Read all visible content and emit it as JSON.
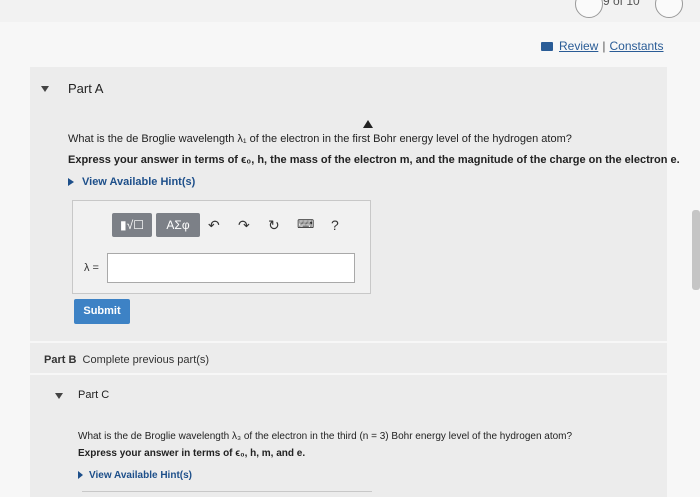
{
  "header": {
    "page_counter": "9 of 10",
    "review_label": "Review",
    "separator": "|",
    "constants_label": "Constants"
  },
  "partA": {
    "title": "Part A",
    "question": "What is the de Broglie wavelength λ₁ of the electron in the first Bohr energy level of the hydrogen atom?",
    "instruction": "Express your answer in terms of ϵ₀, h, the mass of the electron m, and the magnitude of the charge on the electron e.",
    "hint_label": "View Available Hint(s)",
    "toolbar": {
      "template_label": "▮√☐",
      "greek_label": "ΑΣφ",
      "undo_icon": "undo-icon",
      "redo_icon": "redo-icon",
      "reset_icon": "reset-icon",
      "keyboard_icon": "keyboard-icon",
      "help_label": "?"
    },
    "answer_label": "λ =",
    "answer_value": "",
    "submit_label": "Submit"
  },
  "partB": {
    "label": "Part B",
    "text": "Complete previous part(s)"
  },
  "partC": {
    "title": "Part C",
    "question": "What is the de Broglie wavelength λ₃ of the electron in the third (n = 3) Bohr energy level of the hydrogen atom?",
    "instruction": "Express your answer in terms of ϵ₀, h, m, and e.",
    "hint_label": "View Available Hint(s)"
  },
  "colors": {
    "link": "#2a5c96",
    "hint": "#1d4f8a",
    "submit": "#3d82c5",
    "toolbar_button": "#7c8087"
  }
}
